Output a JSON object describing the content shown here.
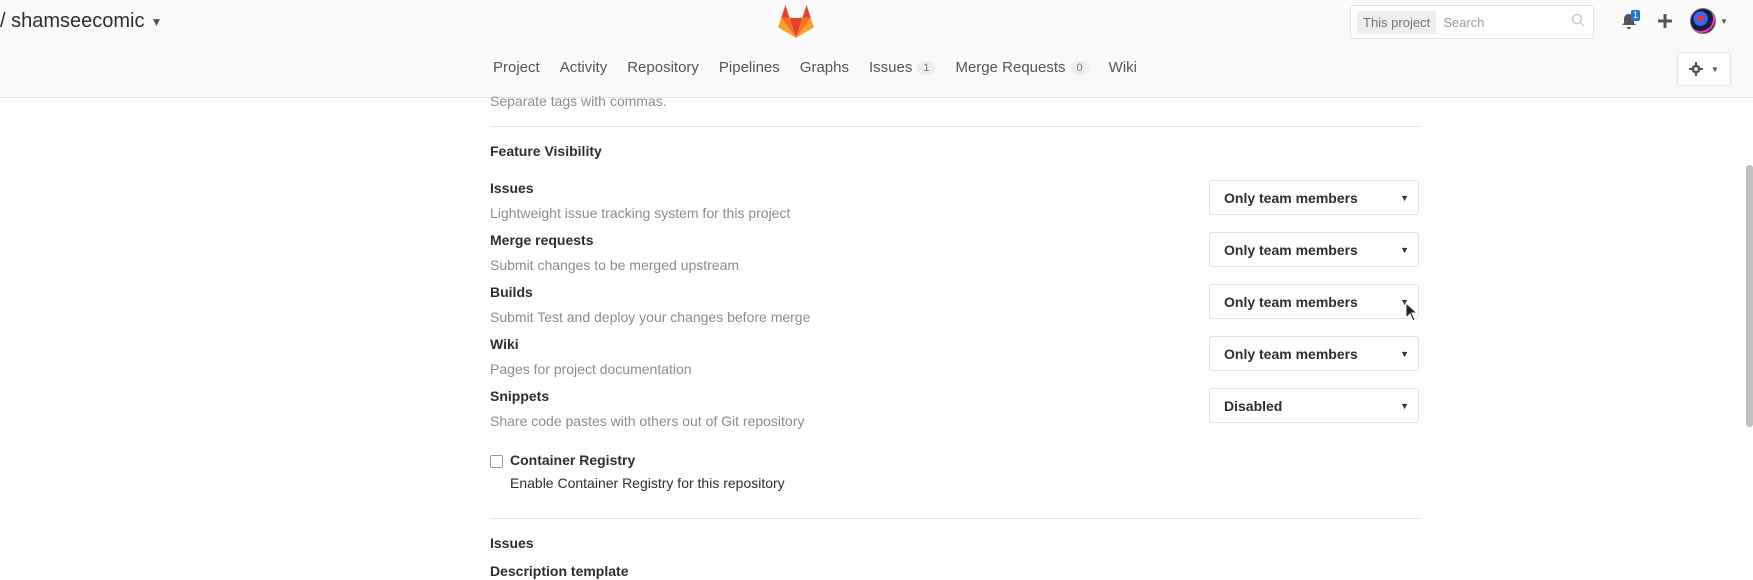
{
  "header": {
    "project_name": "/ shamseecomic",
    "search": {
      "scope": "This project",
      "placeholder": "Search"
    },
    "notifications_count": "1"
  },
  "nav": {
    "items": [
      {
        "label": "Project"
      },
      {
        "label": "Activity"
      },
      {
        "label": "Repository"
      },
      {
        "label": "Pipelines"
      },
      {
        "label": "Graphs"
      },
      {
        "label": "Issues",
        "count": "1"
      },
      {
        "label": "Merge Requests",
        "count": "0"
      },
      {
        "label": "Wiki"
      }
    ]
  },
  "tags_hint": "Separate tags with commas.",
  "feature_visibility": {
    "title": "Feature Visibility",
    "features": [
      {
        "label": "Issues",
        "desc": "Lightweight issue tracking system for this project",
        "value": "Only team members"
      },
      {
        "label": "Merge requests",
        "desc": "Submit changes to be merged upstream",
        "value": "Only team members"
      },
      {
        "label": "Builds",
        "desc": "Submit Test and deploy your changes before merge",
        "value": "Only team members"
      },
      {
        "label": "Wiki",
        "desc": "Pages for project documentation",
        "value": "Only team members"
      },
      {
        "label": "Snippets",
        "desc": "Share code pastes with others out of Git repository",
        "value": "Disabled"
      }
    ]
  },
  "container_registry": {
    "label": "Container Registry",
    "desc": "Enable Container Registry for this repository",
    "checked": false
  },
  "issues_section": {
    "title": "Issues",
    "subtitle": "Description template"
  },
  "colors": {
    "accent": "#1f78d1",
    "muted": "#8c8c8c",
    "logo": "#e24329"
  }
}
